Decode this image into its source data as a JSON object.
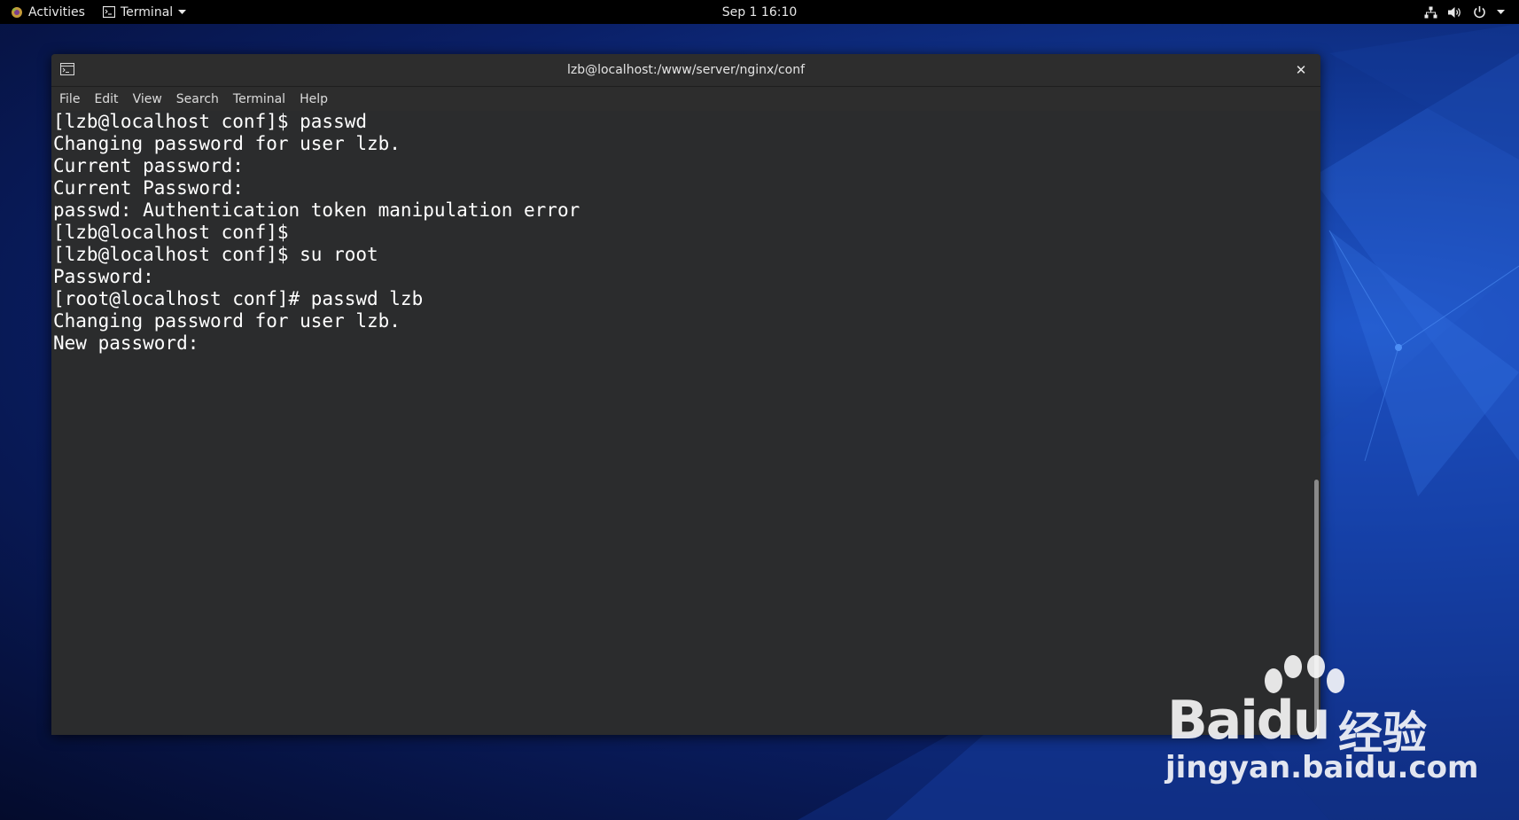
{
  "topbar": {
    "activities_label": "Activities",
    "app_menu_label": "Terminal",
    "clock": "Sep 1  16:10",
    "icons": [
      "network-icon",
      "volume-icon",
      "power-icon",
      "chevron-down-icon"
    ]
  },
  "window": {
    "title": "lzb@localhost:/www/server/nginx/conf",
    "menu": [
      "File",
      "Edit",
      "View",
      "Search",
      "Terminal",
      "Help"
    ]
  },
  "terminal": {
    "lines": [
      "[lzb@localhost conf]$ passwd",
      "Changing password for user lzb.",
      "Current password:",
      "Current Password:",
      "passwd: Authentication token manipulation error",
      "[lzb@localhost conf]$",
      "[lzb@localhost conf]$ su root",
      "Password:",
      "[root@localhost conf]# passwd lzb",
      "Changing password for user lzb.",
      "New password:"
    ]
  },
  "watermark": {
    "brand": "Baidu",
    "brand_cn": "经验",
    "url": "jingyan.baidu.com"
  },
  "colors": {
    "terminal_bg": "#2b2c2d",
    "terminal_fg": "#ffffff",
    "topbar_bg": "#000000",
    "desktop_accent": "#1f55c8"
  }
}
